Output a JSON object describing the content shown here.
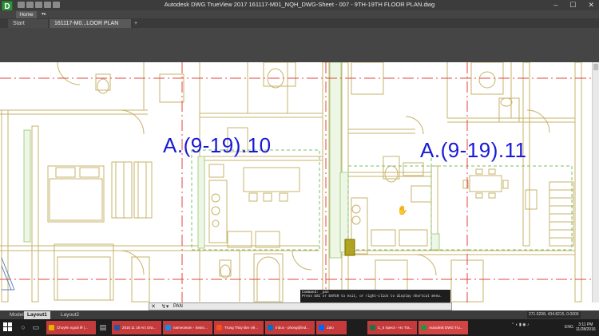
{
  "titlebar": {
    "app_icon": "D",
    "title": "Autodesk DWG TrueView 2017     161117-M01_NQH_DWG-Sheet - 007 - 9TH-19TH FLOOR PLAN.dwg",
    "min": "–",
    "max": "☐",
    "close": "✕"
  },
  "ribbon": {
    "home_tab": "Home",
    "arrow": "▾▸"
  },
  "doc_tabs": {
    "start": "Start",
    "file": "161117-M0...LOOR PLAN",
    "add": "+"
  },
  "drawing": {
    "label_left": "A.(9-19).10",
    "label_right": "A.(9-19).11",
    "line_color": "#c7b36a",
    "grid_color": "#e0453f",
    "hatch_color": "#a8d08d",
    "label_color": "#1a1ad6"
  },
  "command": {
    "history_1": "Command: _pan",
    "history_2": "Press ESC or ENTER to exit, or right-click to display shortcut menu.",
    "x": "✕",
    "icon": "↯▾",
    "input": "PAN"
  },
  "layout_tabs": {
    "model": "Model",
    "layout1": "Layout1",
    "layout2": "Layout2"
  },
  "coords": "271.5208, 434.8215, 0.0000",
  "taskbar": {
    "items": [
      {
        "label": "Chuyên ngoài lề |...",
        "color": "#e0b500"
      },
      {
        "label": "2016 11 18 Arc Dra...",
        "color": "#2b579a"
      },
      {
        "label": "namecteam - Searc...",
        "color": "#1e88e5"
      },
      {
        "label": "Trung Thủy làm việ...",
        "color": "#f4511e"
      },
      {
        "label": "Inbox - phong@ind...",
        "color": "#0072c6"
      },
      {
        "label": "Zalo",
        "color": "#0068ff"
      },
      {
        "label": "C_5 Specs - Ho Tra...",
        "color": "#217346"
      },
      {
        "label": "Autodesk DWG Tru...",
        "color": "#2f8f3a"
      }
    ],
    "lang": "ENG",
    "time": "3:11 PM",
    "date": "11/28/2016"
  }
}
